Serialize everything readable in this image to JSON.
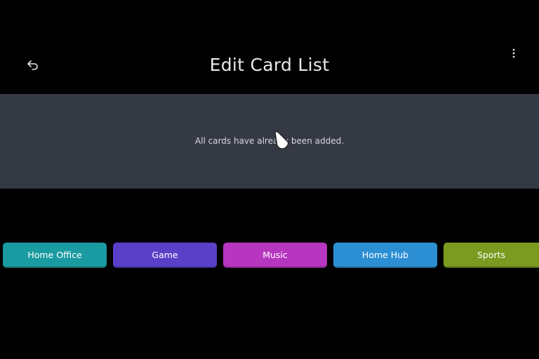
{
  "header": {
    "title": "Edit Card List",
    "back_icon": "back-arrow-icon",
    "more_icon": "more-vertical-icon"
  },
  "panel": {
    "message": "All cards have already been added."
  },
  "cards": [
    {
      "label": "Home Office",
      "color": "#1a9ba1"
    },
    {
      "label": "Game",
      "color": "#5a40c8"
    },
    {
      "label": "Music",
      "color": "#b636c0"
    },
    {
      "label": "Home Hub",
      "color": "#2c8fd4"
    },
    {
      "label": "Sports",
      "color": "#7a9a20"
    }
  ],
  "colors": {
    "background": "#000000",
    "panel": "#353944",
    "title_text": "#e9e9ec"
  }
}
